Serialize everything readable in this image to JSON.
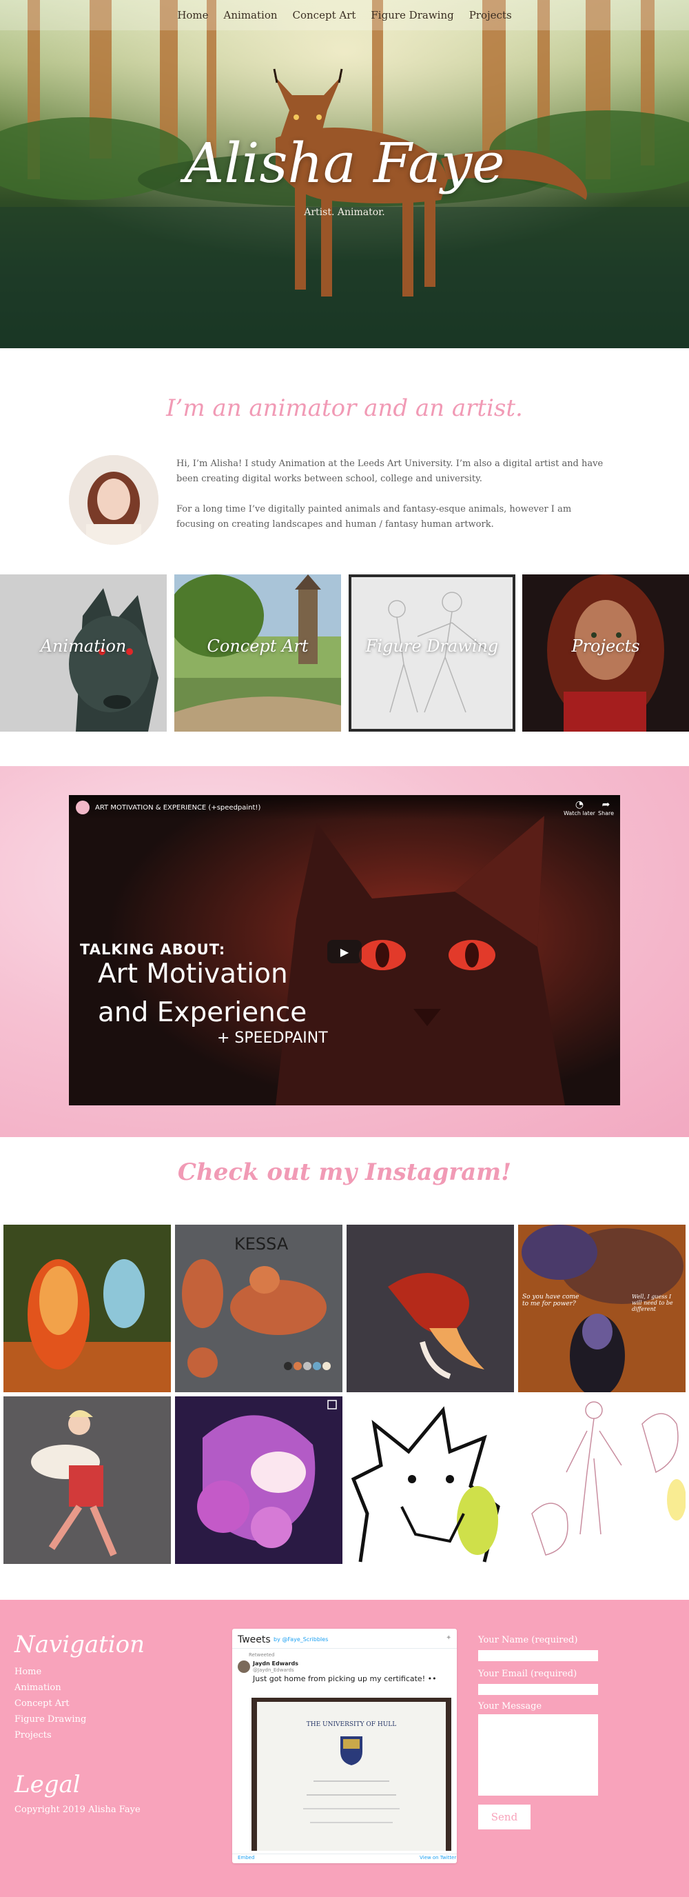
{
  "nav": {
    "items": [
      "Home",
      "Animation",
      "Concept Art",
      "Figure Drawing",
      "Projects"
    ]
  },
  "hero": {
    "title": "Alisha Faye",
    "subtitle": "Artist. Animator."
  },
  "about": {
    "heading": "I’m an animator and an artist.",
    "paragraph1": "Hi, I’m Alisha! I study Animation at the Leeds Art University. I’m also a digital artist and have been creating digital works between school, college and university.",
    "paragraph2": "For a long time I’ve digitally painted animals and fantasy-esque animals, however I am focusing on creating landscapes and human / fantasy human artwork."
  },
  "tiles": [
    {
      "label": "Animation"
    },
    {
      "label": "Concept Art"
    },
    {
      "label": "Figure Drawing"
    },
    {
      "label": "Projects"
    }
  ],
  "video": {
    "title": "ART MOTIVATION & EXPERIENCE (+speedpaint!)",
    "watch_later": "Watch later",
    "share": "Share",
    "thumb_line1": "TALKING ABOUT:",
    "thumb_line2": "Art Motivation and Experience",
    "thumb_line3": "+ SPEEDPAINT"
  },
  "instagram": {
    "heading": "Check out my Instagram!",
    "kessa_label": "KESSA",
    "comic_text1": "So you have come to me for power?",
    "comic_text2": "Well, I guess I will need to be different"
  },
  "footer": {
    "nav_heading": "Navigation",
    "nav_links": [
      "Home",
      "Animation",
      "Concept Art",
      "Figure Drawing",
      "Projects"
    ],
    "legal_heading": "Legal",
    "copyright": "Copyright 2019 Alisha Faye",
    "tweets": {
      "title": "Tweets",
      "by": "by @Faye_ScribbIes",
      "retweeted": "Retweeted",
      "author": "Jaydn Edwards",
      "handle": "@Jaydn_Edwards",
      "text": "Just got home from picking up my certificate! ••",
      "university": "THE UNIVERSITY OF HULL",
      "embed": "Embed",
      "view_on": "View on Twitter"
    },
    "form": {
      "name_label": "Your Name (required)",
      "email_label": "Your Email (required)",
      "message_label": "Your Message",
      "send": "Send"
    }
  },
  "colors": {
    "accent_pink": "#f19ab5",
    "footer_pink": "#f8a3bb"
  }
}
